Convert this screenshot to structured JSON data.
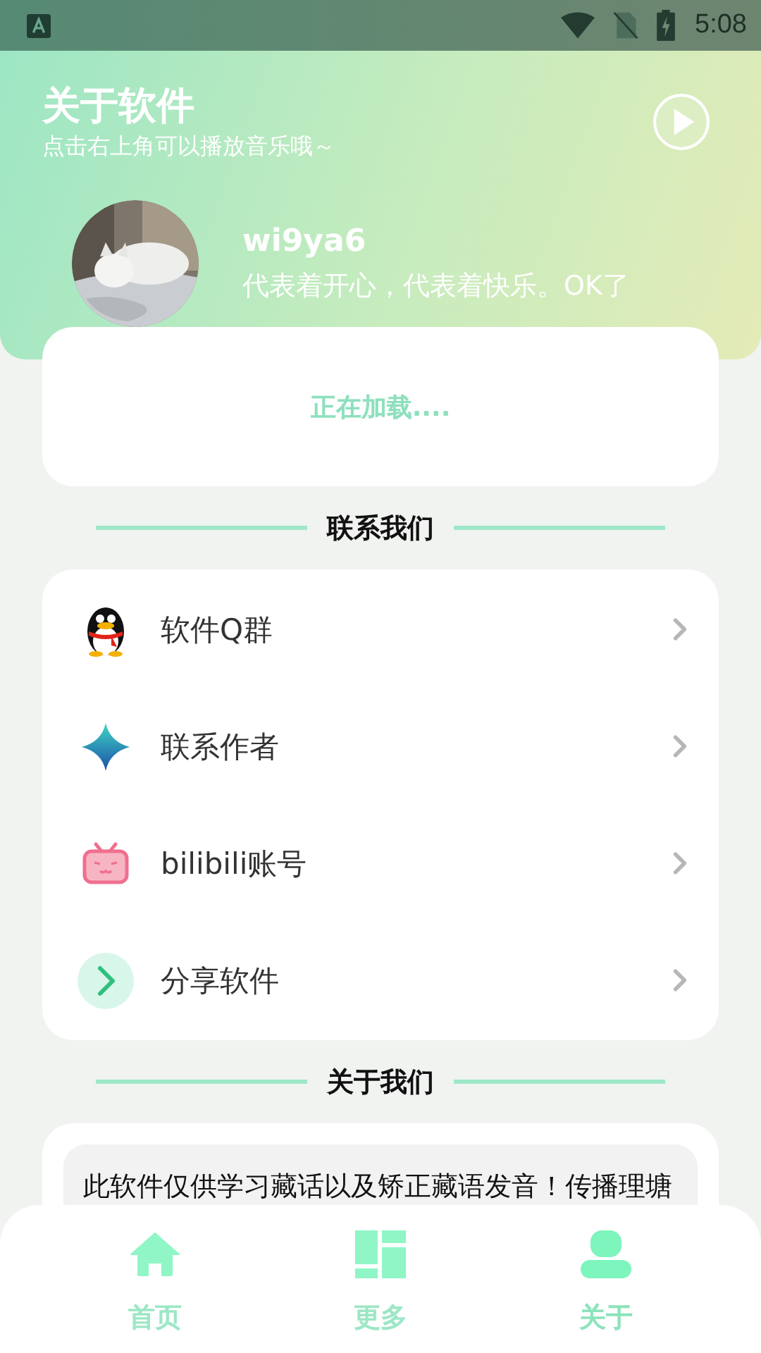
{
  "status_bar": {
    "time": "5:08"
  },
  "header": {
    "title": "关于软件",
    "subtitle": "点击右上角可以播放音乐哦～"
  },
  "profile": {
    "name": "wi9ya6",
    "motto": "代表着开心，代表着快乐。OK了"
  },
  "loading": {
    "text": "正在加载...."
  },
  "contact": {
    "heading": "联系我们",
    "items": [
      {
        "label": "软件Q群",
        "kind": "penguin"
      },
      {
        "label": "联系作者",
        "kind": "star"
      },
      {
        "label": "bilibili账号",
        "kind": "tv"
      },
      {
        "label": "分享软件",
        "kind": "share"
      }
    ]
  },
  "about": {
    "heading": "关于我们",
    "text": "此软件仅供学习藏话以及矫正藏语发音！传播理塘"
  },
  "nav": [
    {
      "label": "首页",
      "kind": "home",
      "selected": false
    },
    {
      "label": "更多",
      "kind": "more",
      "selected": false
    },
    {
      "label": "关于",
      "kind": "user",
      "selected": true
    }
  ]
}
